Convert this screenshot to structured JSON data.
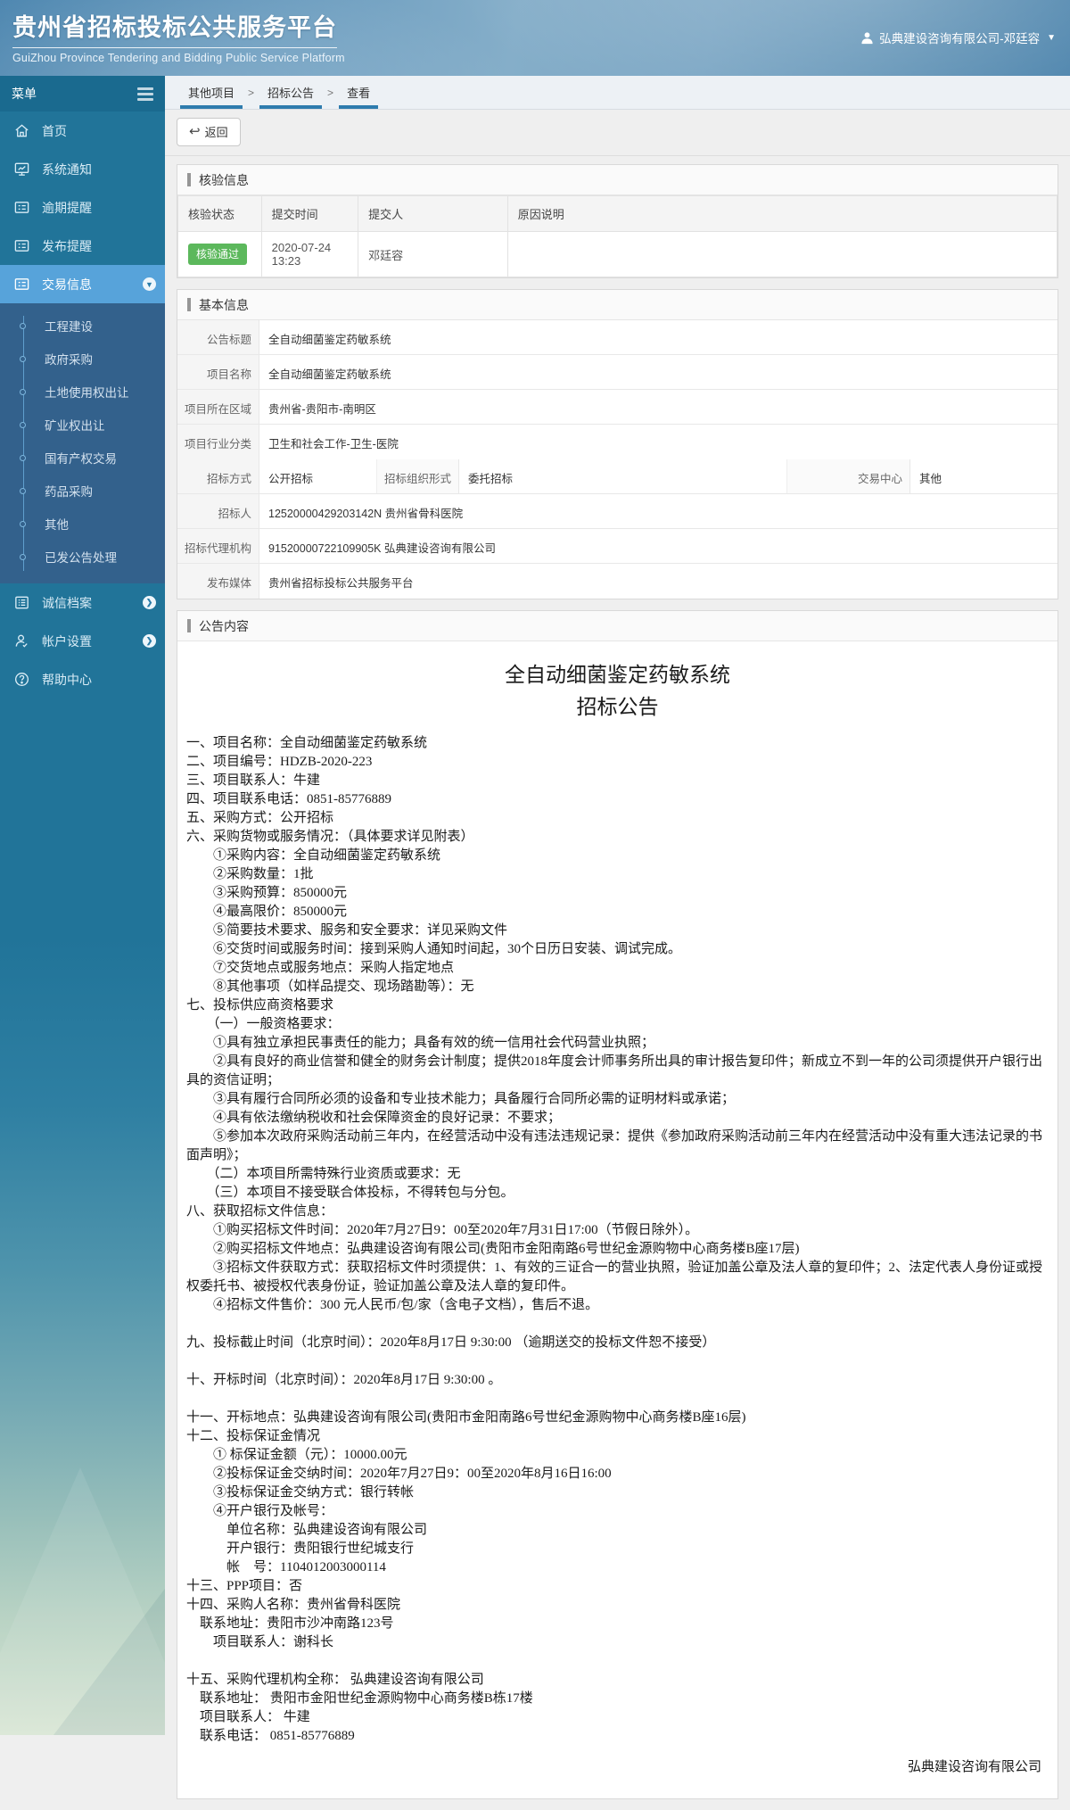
{
  "header": {
    "title": "贵州省招标投标公共服务平台",
    "subtitle": "GuiZhou Province Tendering and Bidding Public Service Platform",
    "user": "弘典建设咨询有限公司-邓廷容"
  },
  "sidebar": {
    "menu_label": "菜单",
    "items": [
      {
        "label": "首页"
      },
      {
        "label": "系统通知"
      },
      {
        "label": "逾期提醒"
      },
      {
        "label": "发布提醒"
      },
      {
        "label": "交易信息"
      }
    ],
    "submenu": [
      "工程建设",
      "政府采购",
      "土地使用权出让",
      "矿业权出让",
      "国有产权交易",
      "药品采购",
      "其他",
      "已发公告处理"
    ],
    "bottom_items": [
      {
        "label": "诚信档案"
      },
      {
        "label": "帐户设置"
      },
      {
        "label": "帮助中心"
      }
    ]
  },
  "breadcrumb": {
    "items": [
      "其他项目",
      "招标公告",
      "查看"
    ],
    "separator": ">"
  },
  "toolbar": {
    "back_label": "返回",
    "back_icon": "↩"
  },
  "verify_section": {
    "title": "核验信息",
    "columns": [
      "核验状态",
      "提交时间",
      "提交人",
      "原因说明"
    ],
    "row": {
      "status": "核验通过",
      "submit_time": "2020-07-24 13:23",
      "submitter": "邓廷容",
      "reason": ""
    }
  },
  "basic_section": {
    "title": "基本信息",
    "rows": [
      {
        "label": "公告标题",
        "value": "全自动细菌鉴定药敏系统"
      },
      {
        "label": "项目名称",
        "value": "全自动细菌鉴定药敏系统"
      },
      {
        "label": "项目所在区域",
        "value": "贵州省-贵阳市-南明区"
      },
      {
        "label": "项目行业分类",
        "value": "卫生和社会工作-卫生-医院"
      }
    ],
    "triple": {
      "l1": "招标方式",
      "v1": "公开招标",
      "l2": "招标组织形式",
      "v2": "委托招标",
      "l3": "交易中心",
      "v3": "其他"
    },
    "rows2": [
      {
        "label": "招标人",
        "value": "12520000429203142N 贵州省骨科医院"
      },
      {
        "label": "招标代理机构",
        "value": "91520000722109905K 弘典建设咨询有限公司"
      },
      {
        "label": "发布媒体",
        "value": "贵州省招标投标公共服务平台"
      }
    ]
  },
  "content_section": {
    "title": "公告内容",
    "doc_title1": "全自动细菌鉴定药敏系统",
    "doc_title2": "招标公告",
    "paragraphs": [
      "一、项目名称：全自动细菌鉴定药敏系统",
      "二、项目编号：HDZB-2020-223",
      "三、项目联系人：牛建",
      "四、项目联系电话：0851-85776889",
      "五、采购方式：公开招标",
      "六、采购货物或服务情况：（具体要求详见附表）",
      "　　①采购内容：全自动细菌鉴定药敏系统",
      "　　②采购数量：1批",
      "　　③采购预算：850000元",
      "　　④最高限价：850000元",
      "　　⑤简要技术要求、服务和安全要求：详见采购文件",
      "　　⑥交货时间或服务时间：接到采购人通知时间起，30个日历日安装、调试完成。",
      "　　⑦交货地点或服务地点：采购人指定地点",
      "　　⑧其他事项（如样品提交、现场踏勘等）：无",
      "七、投标供应商资格要求",
      "　　（一）一般资格要求：",
      "　　①具有独立承担民事责任的能力；具备有效的统一信用社会代码营业执照；",
      "　　②具有良好的商业信誉和健全的财务会计制度；提供2018年度会计师事务所出具的审计报告复印件；新成立不到一年的公司须提供开户银行出具的资信证明；",
      "　　③具有履行合同所必须的设备和专业技术能力；具备履行合同所必需的证明材料或承诺；",
      "　　④具有依法缴纳税收和社会保障资金的良好记录：不要求；",
      "　　⑤参加本次政府采购活动前三年内，在经营活动中没有违法违规记录：提供《参加政府采购活动前三年内在经营活动中没有重大违法记录的书面声明》；",
      "　　（二）本项目所需特殊行业资质或要求：无",
      "　　（三）本项目不接受联合体投标，不得转包与分包。",
      "八、获取招标文件信息：",
      "　　①购买招标文件时间：2020年7月27日9：00至2020年7月31日17:00（节假日除外）。",
      "　　②购买招标文件地点：弘典建设咨询有限公司(贵阳市金阳南路6号世纪金源购物中心商务楼B座17层)",
      "　　③招标文件获取方式：获取招标文件时须提供：1、有效的三证合一的营业执照，验证加盖公章及法人章的复印件；2、法定代表人身份证或授权委托书、被授权代表身份证，验证加盖公章及法人章的复印件。",
      "　　④招标文件售价：300 元人民币/包/家（含电子文档），售后不退。",
      "",
      "九、投标截止时间（北京时间）：2020年8月17日 9:30:00 （逾期送交的投标文件恕不接受）",
      "",
      "十、开标时间（北京时间）：2020年8月17日 9:30:00 。",
      "",
      "十一、开标地点：弘典建设咨询有限公司(贵阳市金阳南路6号世纪金源购物中心商务楼B座16层)",
      "十二、投标保证金情况",
      "　　① 标保证金额（元）：10000.00元",
      "　　②投标保证金交纳时间：2020年7月27日9：00至2020年8月16日16:00",
      "　　③投标保证金交纳方式：银行转帐",
      "　　④开户银行及帐号：",
      "　　　单位名称：弘典建设咨询有限公司",
      "　　　开户银行：贵阳银行世纪城支行",
      "　　　帐　号：1104012003000114",
      "十三、PPP项目：否",
      "十四、采购人名称：贵州省骨科医院",
      "　联系地址：贵阳市沙冲南路123号",
      "　　项目联系人：谢科长",
      "",
      "十五、采购代理机构全称： 弘典建设咨询有限公司",
      "　联系地址： 贵阳市金阳世纪金源购物中心商务楼B栋17楼",
      "　项目联系人： 牛建",
      "　联系电话： 0851-85776889"
    ],
    "signature": "弘典建设咨询有限公司"
  },
  "colors": {
    "header_teal": "#1a6a8f",
    "sidebar_teal": "#217499",
    "active_item": "#57a3da",
    "submenu_navy": "#33618c",
    "crumb_underline": "#2e7cae",
    "badge_green": "#5cb85c"
  }
}
